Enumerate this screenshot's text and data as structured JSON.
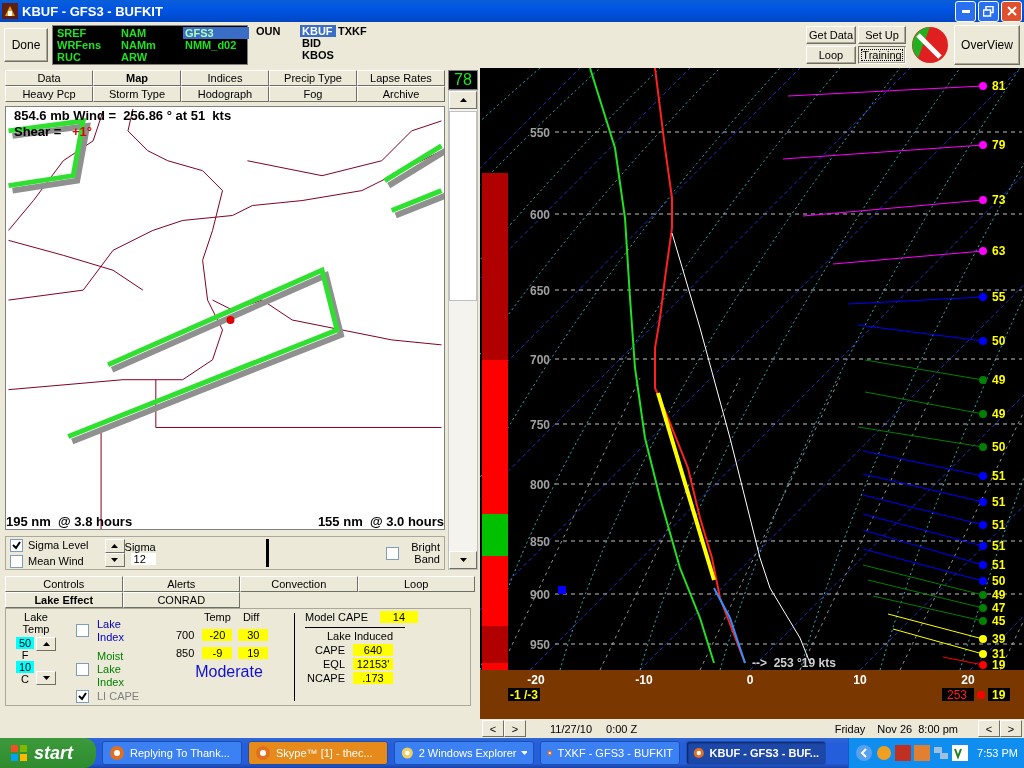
{
  "window": {
    "title": "KBUF - GFS3 - BUFKIT"
  },
  "toolbar": {
    "done": "Done",
    "model_columns": [
      [
        {
          "label": "SREF",
          "selected": false
        },
        {
          "label": "WRFens",
          "selected": false
        },
        {
          "label": "RUC",
          "selected": false
        }
      ],
      [
        {
          "label": "NAM",
          "selected": false
        },
        {
          "label": "NAMm",
          "selected": false
        },
        {
          "label": "ARW",
          "selected": false
        }
      ],
      [
        {
          "label": "GFS3",
          "selected": true
        },
        {
          "label": "NMM_d02",
          "selected": false
        }
      ]
    ],
    "station_columns": [
      [
        {
          "label": "OUN",
          "selected": false
        }
      ],
      [
        {
          "label": "KBUF",
          "selected": true
        },
        {
          "label": "BID",
          "selected": false
        },
        {
          "label": "KBOS",
          "selected": false
        }
      ],
      [
        {
          "label": "TXKF",
          "selected": false
        }
      ]
    ],
    "buttons": [
      {
        "label": "Get Data",
        "pressed": false
      },
      {
        "label": "Set Up",
        "pressed": false
      },
      {
        "label": "Loop",
        "pressed": false
      },
      {
        "label": "Training",
        "pressed": true
      }
    ],
    "overview": "OverView"
  },
  "top_tabs": [
    [
      {
        "label": "Data",
        "selected": false
      },
      {
        "label": "Map",
        "selected": true
      },
      {
        "label": "Indices",
        "selected": false
      },
      {
        "label": "Precip Type",
        "selected": false
      },
      {
        "label": "Lapse Rates",
        "selected": false
      }
    ],
    [
      {
        "label": "Heavy Pcp",
        "selected": false
      },
      {
        "label": "Storm Type",
        "selected": false
      },
      {
        "label": "Hodograph",
        "selected": false
      },
      {
        "label": "Fog",
        "selected": false
      },
      {
        "label": "Archive",
        "selected": false
      }
    ]
  ],
  "counter": "78",
  "map": {
    "wind_readout": "854.6 mb Wind =  256.86 ° at 51  kts",
    "shear_label": "Shear =",
    "shear_value": "+1°",
    "left_distance": "195 nm  @ 3.8 hours",
    "right_distance": "155 nm  @ 3.0 hours"
  },
  "controls": {
    "checks": [
      {
        "label": "Sigma Level",
        "checked": true
      },
      {
        "label": "Mean Wind",
        "checked": false
      }
    ],
    "sigma_label": "Sigma",
    "sigma_value": "12",
    "bright_band": {
      "label": "Bright Band",
      "checked": false
    }
  },
  "bottom_tabs": [
    [
      {
        "label": "Controls",
        "selected": false
      },
      {
        "label": "Alerts",
        "selected": false
      },
      {
        "label": "Convection",
        "selected": false
      },
      {
        "label": "Loop",
        "selected": false
      }
    ],
    [
      {
        "label": "Lake Effect",
        "selected": true
      },
      {
        "label": "CONRAD",
        "selected": false
      }
    ]
  ],
  "lake_effect": {
    "lake_temp_label": "Lake Temp",
    "temp_f": "50",
    "unit_f": "F",
    "temp_c": "10",
    "unit_c": "C",
    "options": [
      {
        "label": "Lake Index",
        "checked": false,
        "color": "#0000c0"
      },
      {
        "label": "Moist Lake Index",
        "checked": false,
        "color": "#008000"
      },
      {
        "label": "LI CAPE",
        "checked": true,
        "color": "#808080"
      }
    ],
    "columns": [
      "Temp",
      "Diff"
    ],
    "rows": [
      {
        "pressure": "700",
        "temp": "-20",
        "diff": "30"
      },
      {
        "pressure": "850",
        "temp": "-9",
        "diff": "19"
      }
    ],
    "rating": "Moderate",
    "model_cape_label": "Model CAPE",
    "model_cape": "14",
    "induced_title": "Lake Induced",
    "induced": [
      {
        "label": "CAPE",
        "value": "640"
      },
      {
        "label": "EQL",
        "value": "12153'"
      },
      {
        "label": "NCAPE",
        "value": ".173"
      }
    ]
  },
  "sounding": {
    "pressure_labels": [
      "550",
      "600",
      "650",
      "700",
      "750",
      "800",
      "850",
      "900",
      "950"
    ],
    "temp_labels": [
      "-20",
      "-10",
      "0",
      "10",
      "20"
    ],
    "surface_wind": "-->  253 °19 kts",
    "surface_temps": "-1 /-3",
    "surface_dir": "253",
    "surface_speed": "19",
    "winds": [
      {
        "speed": "81",
        "color": "#ff00ff"
      },
      {
        "speed": "79",
        "color": "#ff00ff"
      },
      {
        "speed": "73",
        "color": "#ff00ff"
      },
      {
        "speed": "63",
        "color": "#ff00ff"
      },
      {
        "speed": "55",
        "color": "#0000ff"
      },
      {
        "speed": "50",
        "color": "#0000ff"
      },
      {
        "speed": "49",
        "color": "#008000"
      },
      {
        "speed": "49",
        "color": "#008000"
      },
      {
        "speed": "50",
        "color": "#008000"
      },
      {
        "speed": "51",
        "color": "#0000ff"
      },
      {
        "speed": "51",
        "color": "#0000ff"
      },
      {
        "speed": "51",
        "color": "#0000ff"
      },
      {
        "speed": "51",
        "color": "#0000ff"
      },
      {
        "speed": "51",
        "color": "#0000ff"
      },
      {
        "speed": "50",
        "color": "#0000ff"
      },
      {
        "speed": "49",
        "color": "#008000"
      },
      {
        "speed": "47",
        "color": "#008000"
      },
      {
        "speed": "45",
        "color": "#008000"
      },
      {
        "speed": "39",
        "color": "#ffff00"
      },
      {
        "speed": "31",
        "color": "#ffff00"
      },
      {
        "speed": "19",
        "color": "#ff0000"
      }
    ]
  },
  "timebar": {
    "nav_left": [
      "<",
      ">"
    ],
    "valid_date": "11/27/10",
    "valid_time": "0:00 Z",
    "local_day": "Friday",
    "local_time": "Nov 26  8:00 pm",
    "nav_right": [
      "<",
      ">"
    ]
  },
  "taskbar": {
    "start": "start",
    "tasks": [
      {
        "label": "Replying To Thank...",
        "selected": false,
        "highlighted": false,
        "grouped": false
      },
      {
        "label": "Skype™ [1] - thec...",
        "selected": false,
        "highlighted": true,
        "grouped": false
      },
      {
        "label": "2 Windows Explorer",
        "selected": false,
        "highlighted": false,
        "grouped": true
      },
      {
        "label": "TXKF - GFS3 - BUFKIT",
        "selected": false,
        "highlighted": false,
        "grouped": false
      },
      {
        "label": "KBUF - GFS3 - BUF...",
        "selected": true,
        "highlighted": false,
        "grouped": false
      }
    ],
    "clock": "7:53 PM"
  }
}
